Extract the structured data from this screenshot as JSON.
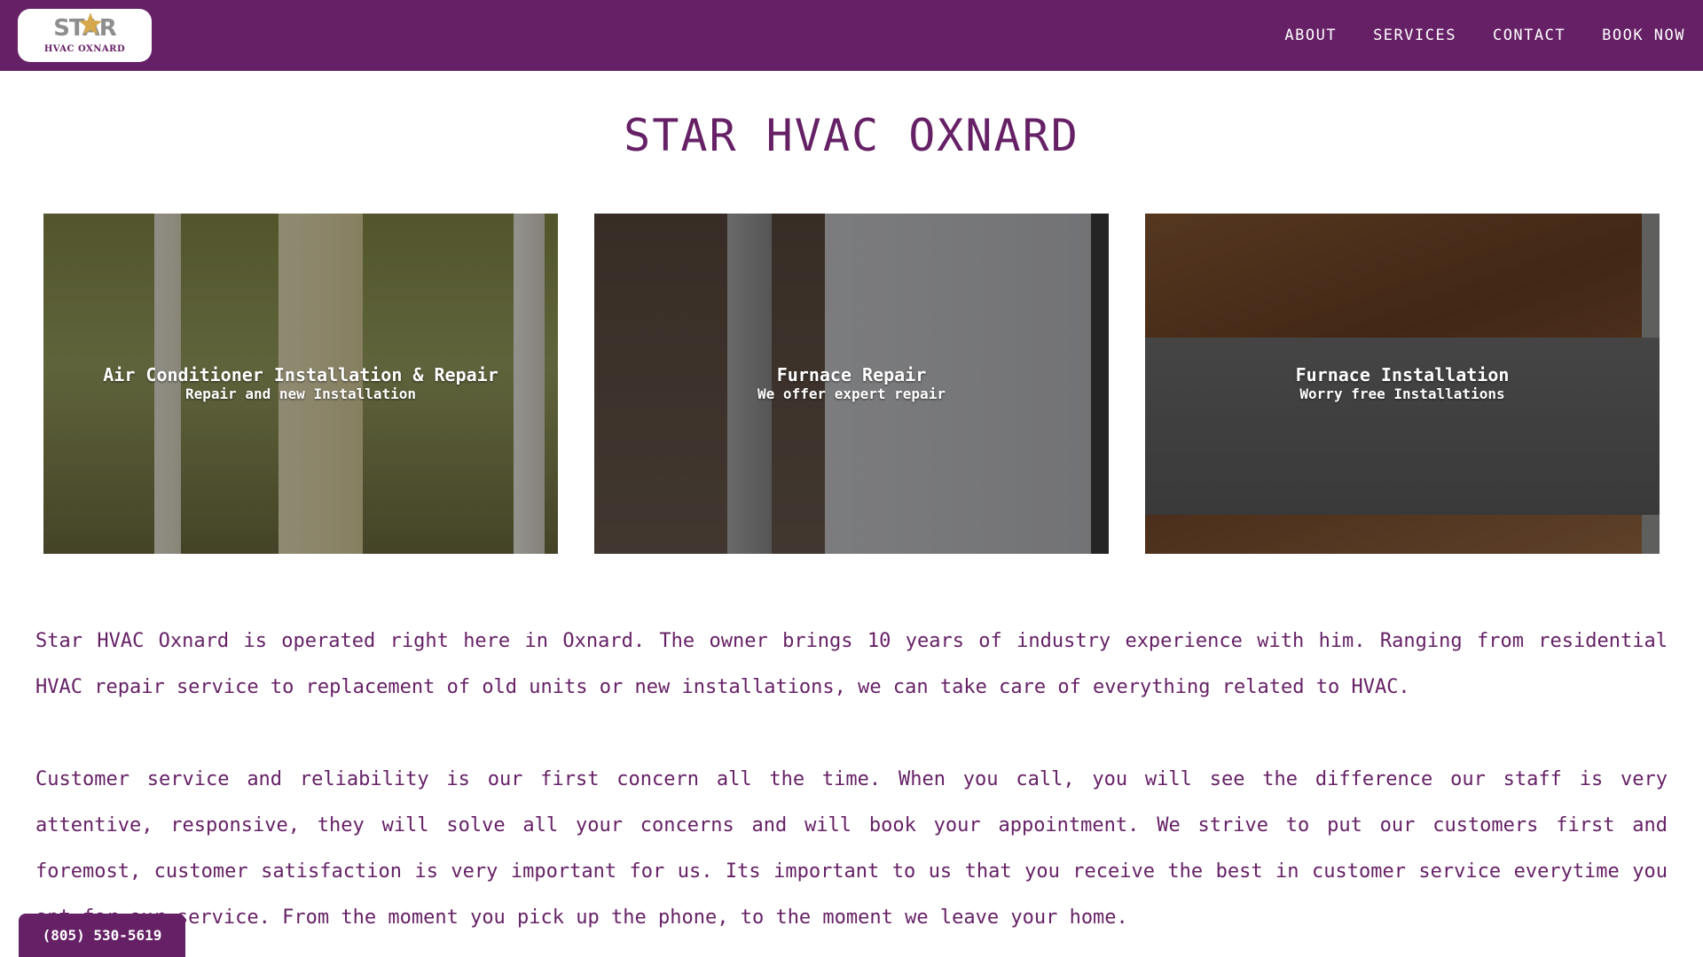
{
  "header": {
    "logo": {
      "word": "STAR",
      "subtitle": "HVAC OXNARD",
      "icon": "star-icon",
      "star_color": "#d4a84b"
    },
    "nav": [
      {
        "label": "ABOUT"
      },
      {
        "label": "SERVICES"
      },
      {
        "label": "CONTACT"
      },
      {
        "label": "BOOK NOW"
      }
    ]
  },
  "main": {
    "title": "STAR HVAC OXNARD",
    "services": [
      {
        "title": "Air Conditioner Installation & Repair",
        "subtitle": "Repair and new Installation"
      },
      {
        "title": "Furnace Repair",
        "subtitle": "We offer expert repair"
      },
      {
        "title": "Furnace Installation",
        "subtitle": "Worry free Installations"
      }
    ],
    "paragraphs": [
      "Star HVAC Oxnard is operated right here in Oxnard. The owner brings 10 years of industry experience with him. Ranging from residential HVAC repair service to replacement of old units or new installations, we can take care of everything related to HVAC.",
      "Customer service and reliability is our first concern all the time. When you call, you will see the difference our staff is very attentive, responsive, they will solve all your concerns and will book your appointment. We strive to put our customers first and foremost, customer satisfaction is very important for us. Its important to us that you receive the best in customer service everytime you opt for our service. From the moment you pick up the phone, to the moment we leave your home."
    ]
  },
  "phone_button": {
    "label": "(805) 530-5619"
  },
  "colors": {
    "brand_purple": "#662166",
    "background": "#ffffff",
    "nav_text": "#ffffff"
  }
}
